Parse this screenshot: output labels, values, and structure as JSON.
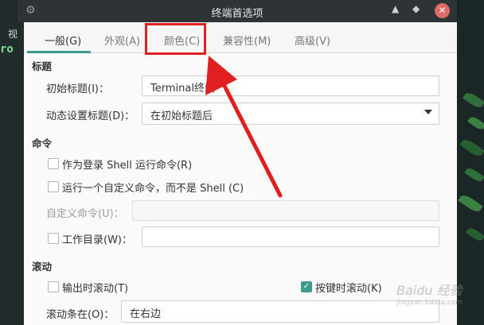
{
  "background": {
    "left_text": "视",
    "left_code": "ro"
  },
  "titlebar": {
    "title": "终端首选项"
  },
  "tabs": [
    {
      "label": "一般(G)",
      "active": true
    },
    {
      "label": "外观(A)",
      "active": false
    },
    {
      "label": "颜色(C)",
      "active": false
    },
    {
      "label": "兼容性(M)",
      "active": false
    },
    {
      "label": "高级(V)",
      "active": false
    }
  ],
  "title_section": {
    "heading": "标题",
    "initial_title_label": "初始标题(I)：",
    "initial_title_value": "Terminal终端",
    "dynamic_title_label": "动态设置标题(D)：",
    "dynamic_title_value": "在初始标题后"
  },
  "command_section": {
    "heading": "命令",
    "login_shell_label": "作为登录 Shell 运行命令(R)",
    "login_shell_checked": false,
    "custom_cmd_label": "运行一个自定义命令，而不是 Shell (C)",
    "custom_cmd_checked": false,
    "custom_cmd_field_label": "自定义命令(U)：",
    "custom_cmd_value": "",
    "workdir_label": "工作目录(W)：",
    "workdir_checked": false,
    "workdir_value": ""
  },
  "scroll_section": {
    "heading": "滚动",
    "scroll_on_output_label": "输出时滚动(T)",
    "scroll_on_output_checked": false,
    "scroll_on_key_label": "按键时滚动(K)",
    "scroll_on_key_checked": true,
    "scrollbar_label": "滚动条在(O)：",
    "scrollbar_value": "在右边"
  },
  "colors": {
    "accent": "#3e9a8c",
    "annotation": "#e02020",
    "titlebar": "#2e3436",
    "close": "#e06a66"
  },
  "watermark": {
    "text": "Baidu 经验",
    "sub": "jingyan.baidu.com"
  }
}
